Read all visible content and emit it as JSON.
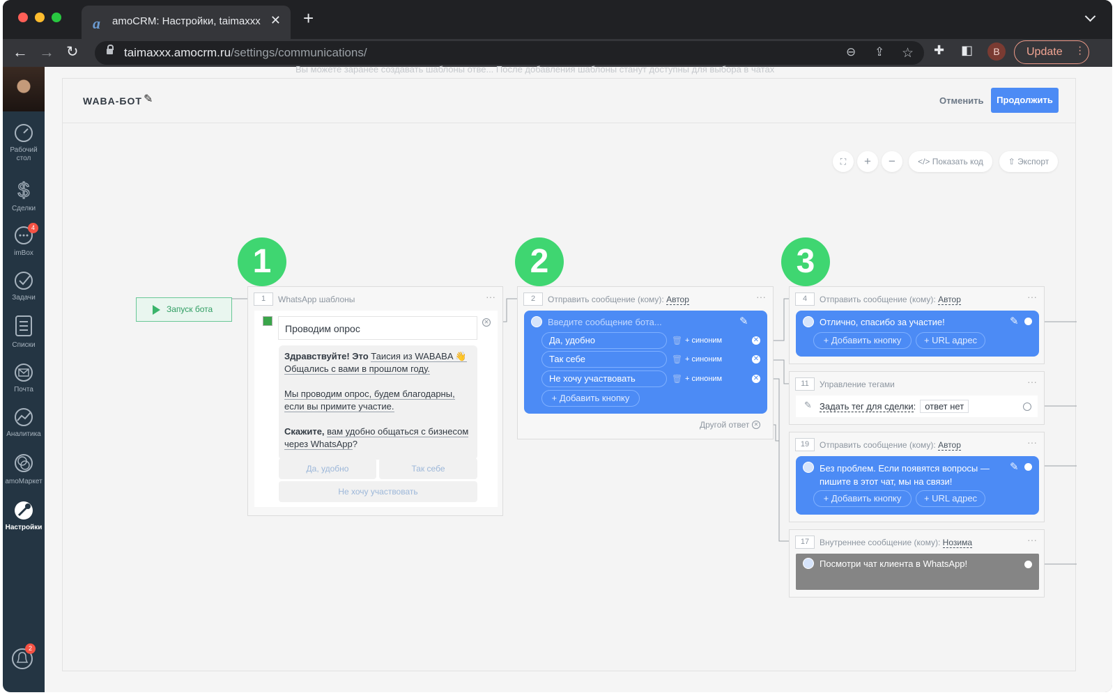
{
  "browser": {
    "tab_title": "amoCRM: Настройки, taimaxxx",
    "url_host": "taimaxxx.amocrm.ru",
    "url_path": "/settings/communications/",
    "profile_letter": "B",
    "update_label": "Update"
  },
  "sidebar": {
    "items": [
      {
        "label": "Рабочий стол",
        "icon": "dashboard-icon"
      },
      {
        "label": "Сделки",
        "icon": "dollar-icon"
      },
      {
        "label": "imBox",
        "icon": "chat-icon",
        "badge": "4"
      },
      {
        "label": "Задачи",
        "icon": "check-icon"
      },
      {
        "label": "Списки",
        "icon": "list-icon"
      },
      {
        "label": "Почта",
        "icon": "mail-icon"
      },
      {
        "label": "Аналитика",
        "icon": "analytics-icon"
      },
      {
        "label": "amoМаркет",
        "icon": "market-icon"
      },
      {
        "label": "Настройки",
        "icon": "wrench-icon"
      }
    ],
    "notifications_badge": "2"
  },
  "background_text": "Вы можете заранее создавать шаблоны отве... После добавления шаблоны станут доступны для выбора в чатах",
  "editor": {
    "bot_name": "WABA-БОТ",
    "cancel_label": "Отменить",
    "continue_label": "Продолжить",
    "show_code_label": "Показать код",
    "export_label": "Экспорт",
    "step_numbers": [
      "1",
      "2",
      "3"
    ],
    "start_label": "Запуск бота"
  },
  "node1": {
    "index": "1",
    "title": "WhatsApp шаблоны",
    "template_name": "Проводим опрос",
    "greeting_bold": "Здравствуйте! Это",
    "greeting_rest": "Таисия из WABABA 👋",
    "line2": "Общались с вами в прошлом году.",
    "para2a": "Мы проводим опрос, будем благодарны,",
    "para2b": "если вы примите участие.",
    "para3_bold": "Скажите,",
    "para3a": "вам удобно общаться с бизнесом",
    "para3b": "через WhatsApp",
    "para3_q": "?",
    "buttons": [
      "Да, удобно",
      "Так себе",
      "Не хочу участвовать"
    ]
  },
  "node2": {
    "index": "2",
    "title": "Отправить сообщение",
    "to_label": "(кому):",
    "recipient": "Автор",
    "placeholder": "Введите сообщение бота...",
    "buttons": [
      "Да, удобно",
      "Так себе",
      "Не хочу участвовать"
    ],
    "synonym_label": "+ синоним",
    "add_button_label": "+ Добавить кнопку",
    "other_answer": "Другой ответ"
  },
  "node4": {
    "index": "4",
    "title": "Отправить сообщение",
    "to_label": "(кому):",
    "recipient": "Автор",
    "message": "Отлично, спасибо за участие!",
    "add_button_label": "+ Добавить кнопку",
    "url_label": "+ URL адрес"
  },
  "node11": {
    "index": "11",
    "title": "Управление тегами",
    "action": "Задать тег для сделки",
    "colon": ":",
    "tag": "ответ нет"
  },
  "node19": {
    "index": "19",
    "title": "Отправить сообщение",
    "to_label": "(кому):",
    "recipient": "Автор",
    "message_line1": "Без проблем. Если появятся вопросы —",
    "message_line2": "пишите в этот чат, мы на связи!",
    "add_button_label": "+ Добавить кнопку",
    "url_label": "+ URL адрес"
  },
  "node17": {
    "index": "17",
    "title": "Внутреннее сообщение",
    "to_label": "(кому):",
    "recipient": "Нозима",
    "message": "Посмотри чат клиента в WhatsApp!"
  },
  "colors": {
    "accent": "#4c8bf5",
    "step_badge": "#3fd671",
    "sidebar": "#243543"
  }
}
